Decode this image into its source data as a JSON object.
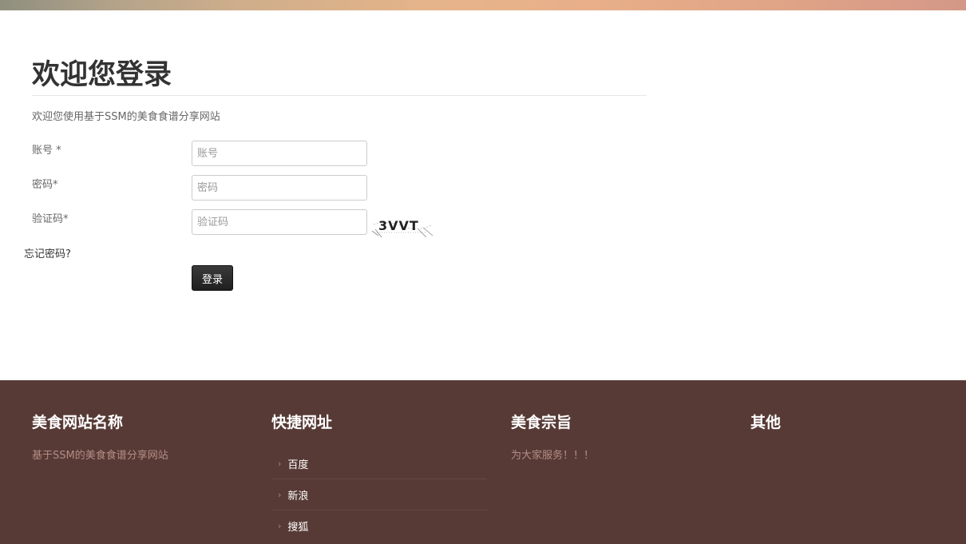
{
  "login": {
    "title": "欢迎您登录",
    "subtitle": "欢迎您使用基于SSM的美食食谱分享网站",
    "fields": [
      {
        "label": "账号 *",
        "placeholder": "账号"
      },
      {
        "label": "密码*",
        "placeholder": "密码"
      },
      {
        "label": "验证码*",
        "placeholder": "验证码"
      }
    ],
    "captcha_text": "3VVT",
    "forgot_password": "忘记密码?",
    "submit_label": "登录"
  },
  "footer": {
    "columns": [
      {
        "heading": "美食网站名称",
        "text": "基于SSM的美食食谱分享网站"
      },
      {
        "heading": "快捷网址",
        "links": [
          "百度",
          "新浪",
          "搜狐"
        ]
      },
      {
        "heading": "美食宗旨",
        "text": "为大家服务！！！"
      },
      {
        "heading": "其他"
      }
    ]
  },
  "colors": {
    "footer_bg": "#573a36",
    "footer_text": "#b48d85",
    "button_bg": "#2b2b2b"
  }
}
